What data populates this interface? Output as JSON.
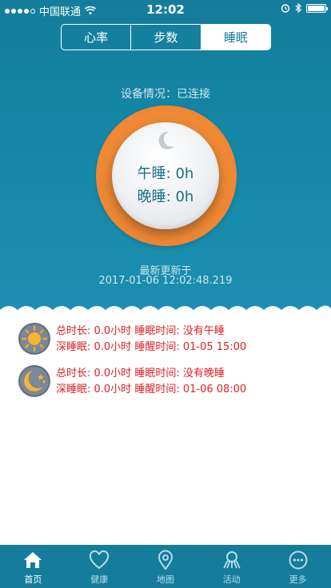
{
  "status_bar": {
    "carrier": "中国联通",
    "time": "12:02"
  },
  "tabs": [
    "心率",
    "步数",
    "睡眠"
  ],
  "device": {
    "status": "设备情况：已连接"
  },
  "sleep": {
    "nap": "午睡: 0h",
    "night": "晚睡: 0h"
  },
  "update": {
    "label": "最新更新于",
    "time": "2017-01-06 12:02:48.219"
  },
  "records": [
    {
      "icon": "sun-icon",
      "line1": "总时长: 0.0小时  睡眠时间: 没有午睡",
      "line2": "深睡眠: 0.0小时  睡醒时间: 01-05 15:00"
    },
    {
      "icon": "moon-stars-icon",
      "line1": "总时长: 0.0小时  睡眠时间: 没有晚睡",
      "line2": "深睡眠: 0.0小时  睡醒时间: 01-06 08:00"
    }
  ],
  "tabbar": [
    {
      "label": "首页",
      "icon": "home-icon"
    },
    {
      "label": "健康",
      "icon": "heart-icon"
    },
    {
      "label": "地图",
      "icon": "map-pin-icon"
    },
    {
      "label": "活动",
      "icon": "activity-icon"
    },
    {
      "label": "更多",
      "icon": "more-icon"
    }
  ],
  "colors": {
    "primary": "#157d9b",
    "orange": "#f08a35",
    "record_text": "#e02020"
  }
}
